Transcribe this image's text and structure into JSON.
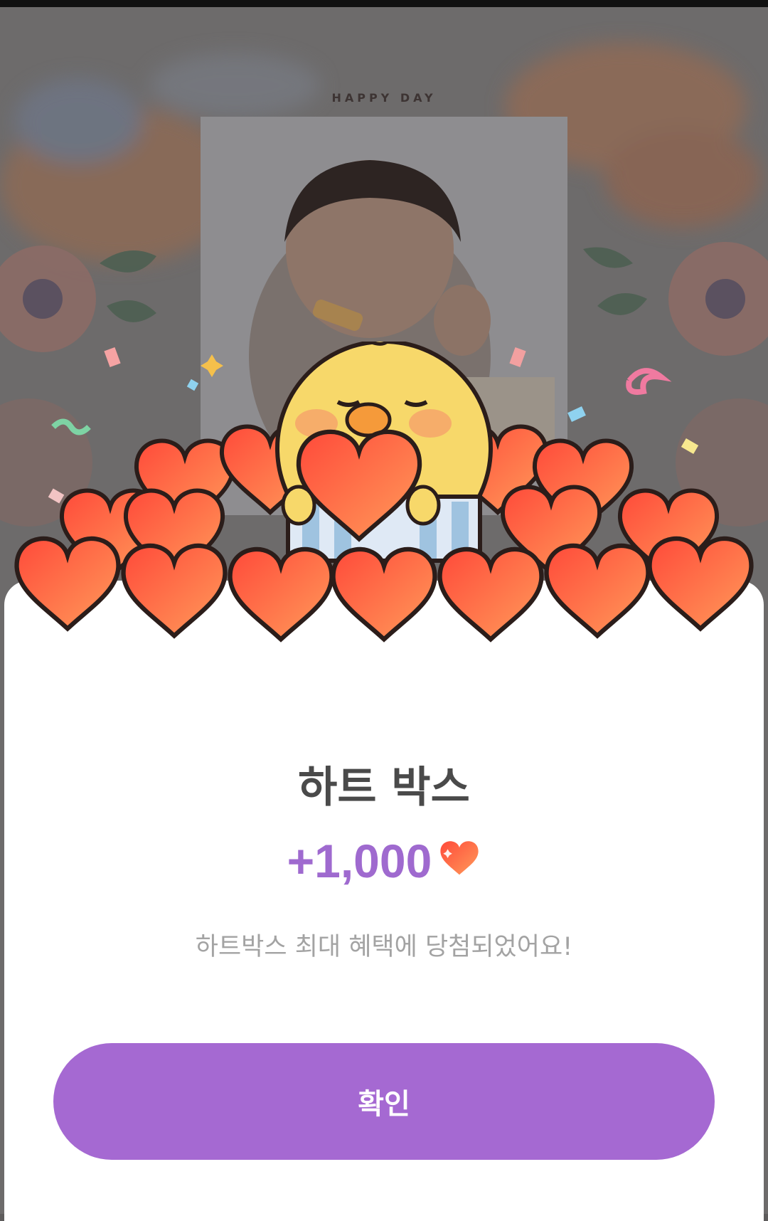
{
  "background": {
    "caption": "HAPPY DAY"
  },
  "popup": {
    "title": "하트 박스",
    "reward_amount": "+1,000",
    "reward_icon": "heart-icon",
    "message": "하트박스 최대 혜택에 당첨되었어요!",
    "confirm_label": "확인"
  },
  "colors": {
    "accent": "#a569d2",
    "reward_text": "#9f6acf",
    "heart": "#ff5a3c"
  }
}
